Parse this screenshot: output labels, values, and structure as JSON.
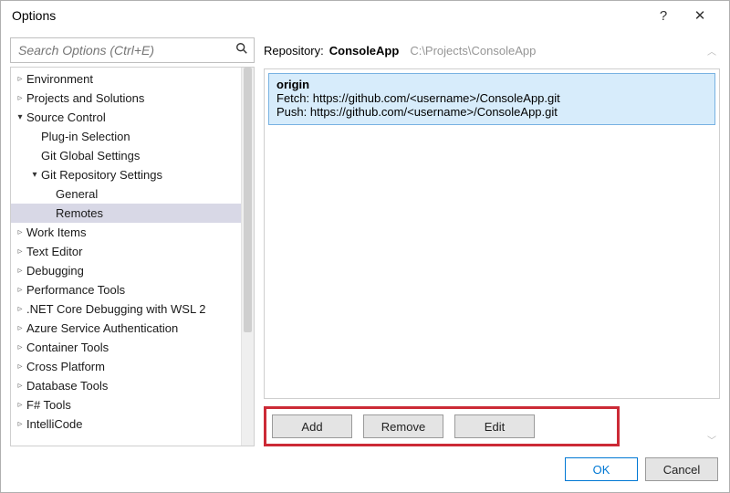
{
  "window": {
    "title": "Options"
  },
  "search": {
    "placeholder": "Search Options (Ctrl+E)"
  },
  "tree": [
    {
      "level": 0,
      "expand": "closed",
      "label": "Environment"
    },
    {
      "level": 0,
      "expand": "closed",
      "label": "Projects and Solutions"
    },
    {
      "level": 0,
      "expand": "open",
      "label": "Source Control"
    },
    {
      "level": 1,
      "expand": "none",
      "label": "Plug-in Selection"
    },
    {
      "level": 1,
      "expand": "none",
      "label": "Git Global Settings"
    },
    {
      "level": 1,
      "expand": "open",
      "label": "Git Repository Settings"
    },
    {
      "level": 2,
      "expand": "none",
      "label": "General"
    },
    {
      "level": 2,
      "expand": "none",
      "label": "Remotes",
      "selected": true
    },
    {
      "level": 0,
      "expand": "closed",
      "label": "Work Items"
    },
    {
      "level": 0,
      "expand": "closed",
      "label": "Text Editor"
    },
    {
      "level": 0,
      "expand": "closed",
      "label": "Debugging"
    },
    {
      "level": 0,
      "expand": "closed",
      "label": "Performance Tools"
    },
    {
      "level": 0,
      "expand": "closed",
      "label": ".NET Core Debugging with WSL 2"
    },
    {
      "level": 0,
      "expand": "closed",
      "label": "Azure Service Authentication"
    },
    {
      "level": 0,
      "expand": "closed",
      "label": "Container Tools"
    },
    {
      "level": 0,
      "expand": "closed",
      "label": "Cross Platform"
    },
    {
      "level": 0,
      "expand": "closed",
      "label": "Database Tools"
    },
    {
      "level": 0,
      "expand": "closed",
      "label": "F# Tools"
    },
    {
      "level": 0,
      "expand": "closed",
      "label": "IntelliCode"
    }
  ],
  "repo": {
    "prefix": "Repository:",
    "name": "ConsoleApp",
    "path": "C:\\Projects\\ConsoleApp"
  },
  "remote": {
    "name": "origin",
    "fetch_label": "Fetch:",
    "fetch_url": "https://github.com/<username>/ConsoleApp.git",
    "push_label": "Push:",
    "push_url": "https://github.com/<username>/ConsoleApp.git"
  },
  "buttons": {
    "add": "Add",
    "remove": "Remove",
    "edit": "Edit",
    "ok": "OK",
    "cancel": "Cancel"
  }
}
